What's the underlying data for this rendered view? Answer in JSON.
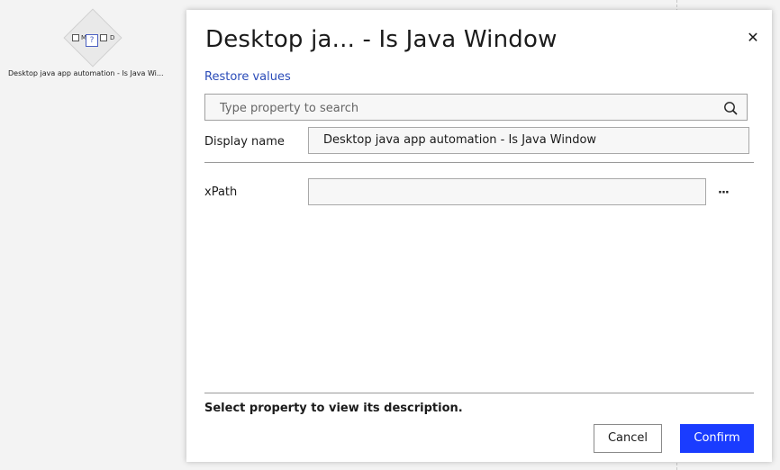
{
  "canvas": {
    "node": {
      "label": "Desktop java app automation - Is Java Wi...",
      "badge_glyph": "?",
      "port_left_letter": "M",
      "port_right_letter": "D"
    }
  },
  "dialog": {
    "title": "Desktop ja... - Is Java Window",
    "close_glyph": "✕",
    "restore_link": "Restore values",
    "search": {
      "placeholder": "Type property to search",
      "value": ""
    },
    "properties": [
      {
        "label": "Display name",
        "value": "Desktop java app automation - Is Java Window"
      },
      {
        "label": "xPath",
        "value": ""
      }
    ],
    "xpath_more": "···",
    "description": "Select property to view its description.",
    "cancel_label": "Cancel",
    "confirm_label": "Confirm"
  },
  "colors": {
    "accent": "#1a3cff",
    "link": "#2a4bb8",
    "canvas_bg": "#f3f3f3"
  },
  "icons": [
    "search-icon",
    "close-icon",
    "node-question-icon"
  ]
}
